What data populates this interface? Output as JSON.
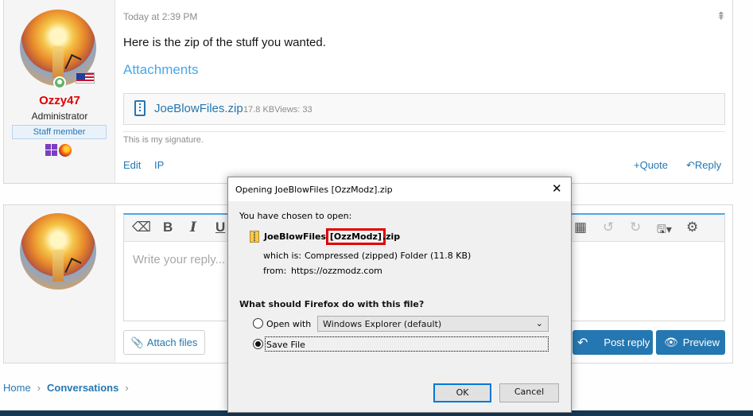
{
  "post": {
    "username": "Ozzy47",
    "user_title": "Administrator",
    "staff_badge": "Staff member",
    "timestamp": "Today at 2:39 PM",
    "body": "Here is the zip of the stuff you wanted.",
    "attachments_heading": "Attachments",
    "attachment": {
      "name": "JoeBlowFiles.zip",
      "meta": "17.8 KBViews: 33"
    },
    "signature": "This is my signature.",
    "actions": {
      "edit": "Edit",
      "ip": "IP",
      "quote": "Quote",
      "reply": "Reply"
    }
  },
  "reply": {
    "placeholder": "Write your reply...",
    "attach_label": "Attach files",
    "post_reply_label": "Post reply",
    "preview_label": "Preview",
    "toolbar": {
      "bold": "B",
      "italic": "I",
      "underline": "U"
    }
  },
  "breadcrumb": {
    "home": "Home",
    "current": "Conversations"
  },
  "dialog": {
    "title": "Opening JoeBlowFiles [OzzModz].zip",
    "intro": "You have chosen to open:",
    "file_name_start": "JoeBlowFiles ",
    "file_name_highlight": "[OzzModz]",
    "file_name_end": ".zip",
    "which_is_label": "which is:",
    "which_is_value": "Compressed (zipped) Folder (11.8 KB)",
    "from_label": "from:",
    "from_value": "https://ozzmodz.com",
    "question": "What should Firefox do with this file?",
    "open_with_label": "Open with",
    "open_with_value": "Windows Explorer (default)",
    "save_file_label": "Save File",
    "ok_label": "OK",
    "cancel_label": "Cancel"
  },
  "colors": {
    "link": "#2577b1",
    "accent": "#47a7eb",
    "username": "#e00000",
    "highlight": "#e00000"
  },
  "icons": [
    "share-icon",
    "file-zip-icon",
    "plus-icon",
    "reply-icon",
    "eraser-icon",
    "table-icon",
    "undo-icon",
    "redo-icon",
    "save-draft-icon",
    "gear-icon",
    "paperclip-icon",
    "eye-icon",
    "chevron-right-icon",
    "close-icon",
    "zip-folder-icon",
    "dropdown-caret-icon"
  ]
}
